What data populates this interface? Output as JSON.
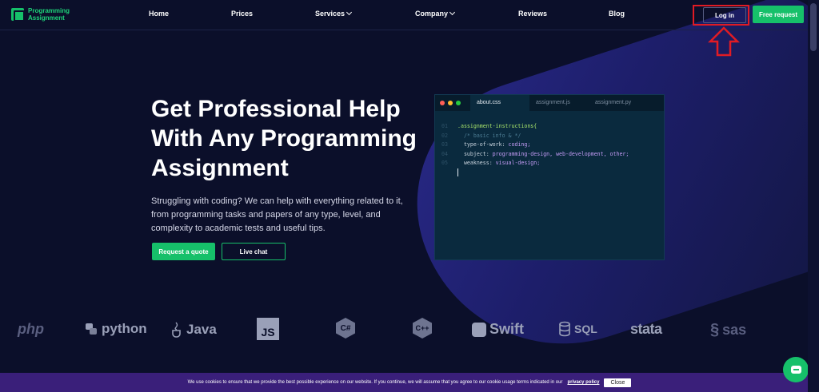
{
  "header": {
    "logo_line1": "Programming",
    "logo_line2": "Assignment",
    "nav": {
      "home": "Home",
      "prices": "Prices",
      "services": "Services",
      "company": "Company",
      "reviews": "Reviews",
      "blog": "Blog"
    },
    "login": "Log in",
    "free_request": "Free request"
  },
  "hero": {
    "title": "Get Professional Help With Any Programming Assignment",
    "subtitle": "Struggling with coding? We can help with everything related to it, from programming tasks and papers of any type, level, and complexity to academic tests and useful tips.",
    "quote_button": "Request a quote",
    "chat_button": "Live chat"
  },
  "editor": {
    "tabs": [
      "about.css",
      "assignment.js",
      "assignment.py"
    ],
    "lines": [
      {
        "n": "01",
        "sel": ".assignment-instructions{"
      },
      {
        "n": "02",
        "comment": "  /* basic info & */"
      },
      {
        "n": "03",
        "prop": "  type-of-work: ",
        "val": "coding;"
      },
      {
        "n": "04",
        "prop": "  subject: ",
        "val": "programming-design, web-development, other;"
      },
      {
        "n": "05",
        "prop": "  weakness: ",
        "val": "visual-design;"
      }
    ]
  },
  "languages": [
    "php",
    "python",
    "Java",
    "JS",
    "C#",
    "C++",
    "Swift",
    "SQL",
    "stata",
    "sas"
  ],
  "cookie": {
    "text": "We use cookies to ensure that we provide the best possible experience on our website. If you continue, we will assume that you agree to our cookie usage terms indicated in our",
    "link": "privacy policy",
    "close": "Close"
  },
  "colors": {
    "accent": "#16c06a",
    "background": "#0b0f2a",
    "highlight": "#e01b24",
    "cookie_bar": "#3a1f7a"
  }
}
